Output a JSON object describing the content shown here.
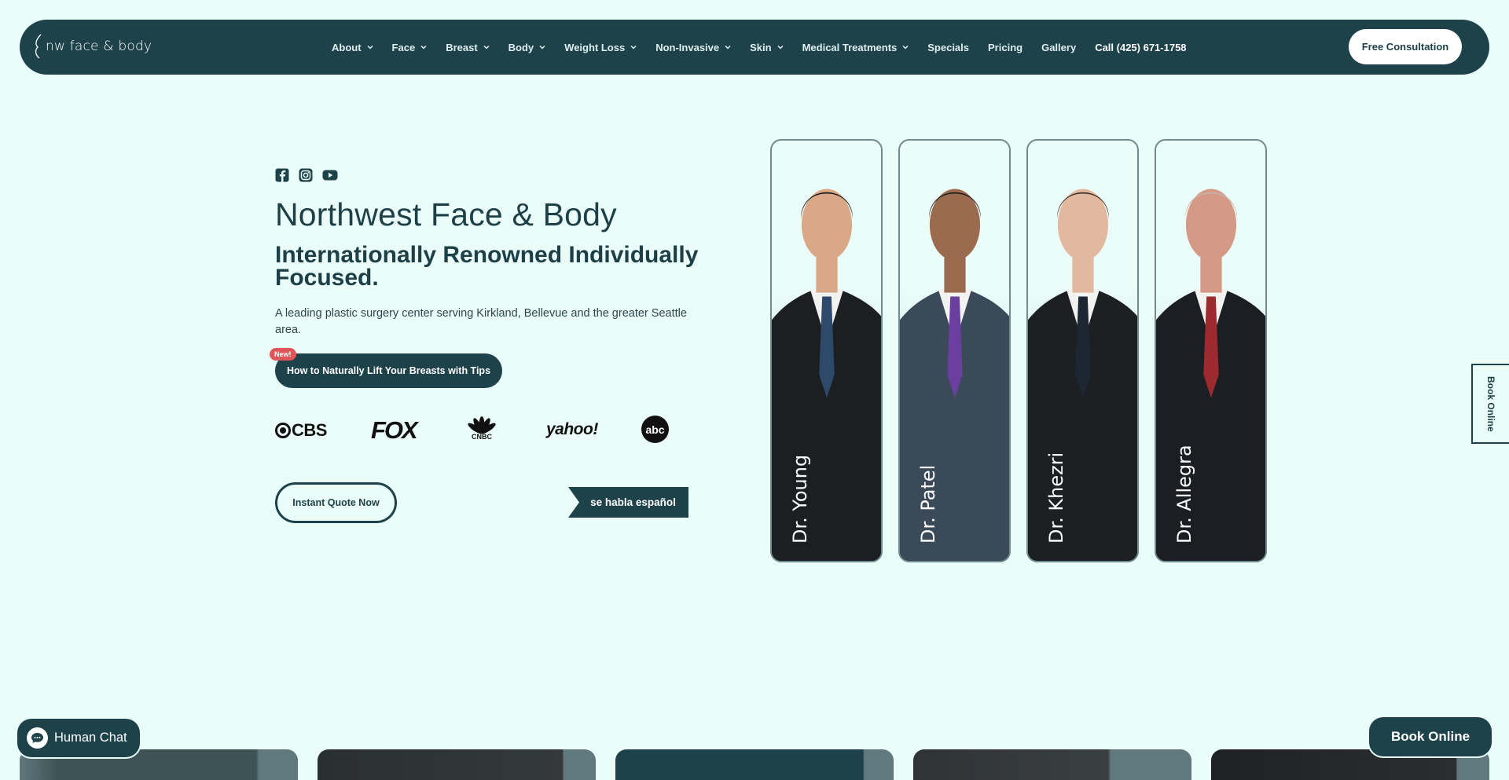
{
  "nav": {
    "logo_text": "nw face & body",
    "items": [
      {
        "label": "About",
        "dropdown": true
      },
      {
        "label": "Face",
        "dropdown": true
      },
      {
        "label": "Breast",
        "dropdown": true
      },
      {
        "label": "Body",
        "dropdown": true
      },
      {
        "label": "Weight Loss",
        "dropdown": true
      },
      {
        "label": "Non-Invasive",
        "dropdown": true
      },
      {
        "label": "Skin",
        "dropdown": true
      },
      {
        "label": "Medical Treatments",
        "dropdown": true
      },
      {
        "label": "Specials",
        "dropdown": false
      },
      {
        "label": "Pricing",
        "dropdown": false
      },
      {
        "label": "Gallery",
        "dropdown": false
      }
    ],
    "phone": "Call (425) 671-1758",
    "cta": "Free Consultation"
  },
  "hero": {
    "social_icons": [
      "facebook-icon",
      "instagram-icon",
      "youtube-icon"
    ],
    "title": "Northwest Face & Body",
    "subtitle": "Internationally Renowned Individually Focused.",
    "description": "A leading plastic surgery center serving Kirkland, Bellevue and the greater Seattle area.",
    "new_badge": "New!",
    "tip_button": "How to Naturally Lift Your Breasts with Tips",
    "press": {
      "cbs": "CBS",
      "fox": "FOX",
      "cnbc": "CNBC",
      "yahoo": "yahoo!",
      "abc": "abc"
    },
    "quote_button": "Instant Quote Now",
    "spanish_label": "se habla español"
  },
  "doctors": [
    {
      "name": "Dr. Young",
      "tie": "#2d4a6b",
      "suit": "#1b1f22",
      "skin": "#d9a987",
      "hair": "#1a1a1a"
    },
    {
      "name": "Dr. Patel",
      "tie": "#6b3fa0",
      "suit": "#3b4a58",
      "skin": "#9a6b4f",
      "hair": "#1c1c1c"
    },
    {
      "name": "Dr. Khezri",
      "tie": "#1c2733",
      "suit": "#1d2023",
      "skin": "#e2b99e",
      "hair": "#3a2f2a"
    },
    {
      "name": "Dr. Allegra",
      "tie": "#9c2a2e",
      "suit": "#1b1e22",
      "skin": "#d49a85",
      "hair": "#c9b6a8"
    }
  ],
  "side_tab": "Book Online",
  "chat_button": "Human Chat",
  "book_button": "Book Online",
  "colors": {
    "background": "#ebfdf9",
    "primary": "#1d424a",
    "badge": "#e0555a"
  }
}
